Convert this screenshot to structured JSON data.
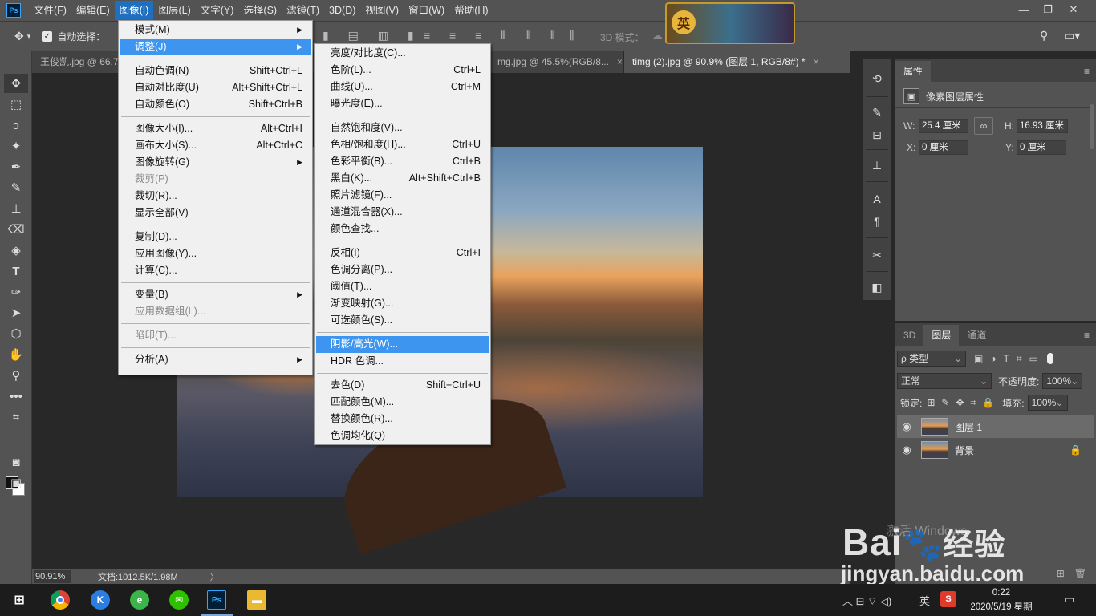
{
  "menubar": {
    "logo": "Ps",
    "items": [
      "文件(F)",
      "编辑(E)",
      "图像(I)",
      "图层(L)",
      "文字(Y)",
      "选择(S)",
      "滤镜(T)",
      "3D(D)",
      "视图(V)",
      "窗口(W)",
      "帮助(H)"
    ],
    "active_index": 2,
    "minimize": "—",
    "restore": "❐",
    "close": "✕",
    "banner_seal": "英"
  },
  "options": {
    "auto_select_label": "自动选择：",
    "mode_3d_label": "3D 模式："
  },
  "tabs": [
    {
      "label": "王俊凯.jpg @ 66.7...",
      "active": false
    },
    {
      "label": "mg.jpg @ 45.5%(RGB/8...",
      "active": false,
      "close": "×"
    },
    {
      "label": "timg (2).jpg @ 90.9% (图层 1, RGB/8#) *",
      "active": true,
      "close": "×"
    }
  ],
  "status": {
    "zoom": "90.91%",
    "doc_info": "文档:1012.5K/1.98M",
    "arrow": "〉"
  },
  "image_menu": {
    "items": [
      {
        "label": "模式(M)",
        "shortcut": "",
        "submenu": true
      },
      {
        "label": "调整(J)",
        "shortcut": "",
        "submenu": true,
        "highlight": true
      },
      {
        "sep": true
      },
      {
        "label": "自动色调(N)",
        "shortcut": "Shift+Ctrl+L"
      },
      {
        "label": "自动对比度(U)",
        "shortcut": "Alt+Shift+Ctrl+L"
      },
      {
        "label": "自动颜色(O)",
        "shortcut": "Shift+Ctrl+B"
      },
      {
        "sep": true
      },
      {
        "label": "图像大小(I)...",
        "shortcut": "Alt+Ctrl+I"
      },
      {
        "label": "画布大小(S)...",
        "shortcut": "Alt+Ctrl+C"
      },
      {
        "label": "图像旋转(G)",
        "shortcut": "",
        "submenu": true
      },
      {
        "label": "裁剪(P)",
        "shortcut": "",
        "disabled": true
      },
      {
        "label": "裁切(R)...",
        "shortcut": ""
      },
      {
        "label": "显示全部(V)",
        "shortcut": ""
      },
      {
        "sep": true
      },
      {
        "label": "复制(D)...",
        "shortcut": ""
      },
      {
        "label": "应用图像(Y)...",
        "shortcut": ""
      },
      {
        "label": "计算(C)...",
        "shortcut": ""
      },
      {
        "sep": true
      },
      {
        "label": "变量(B)",
        "shortcut": "",
        "submenu": true
      },
      {
        "label": "应用数据组(L)...",
        "shortcut": "",
        "disabled": true
      },
      {
        "sep": true
      },
      {
        "label": "陷印(T)...",
        "shortcut": "",
        "disabled": true
      },
      {
        "sep": true
      },
      {
        "label": "分析(A)",
        "shortcut": "",
        "submenu": true
      }
    ]
  },
  "adjust_menu": {
    "items": [
      {
        "label": "亮度/对比度(C)...",
        "shortcut": ""
      },
      {
        "label": "色阶(L)...",
        "shortcut": "Ctrl+L"
      },
      {
        "label": "曲线(U)...",
        "shortcut": "Ctrl+M"
      },
      {
        "label": "曝光度(E)...",
        "shortcut": ""
      },
      {
        "sep": true
      },
      {
        "label": "自然饱和度(V)...",
        "shortcut": ""
      },
      {
        "label": "色相/饱和度(H)...",
        "shortcut": "Ctrl+U"
      },
      {
        "label": "色彩平衡(B)...",
        "shortcut": "Ctrl+B"
      },
      {
        "label": "黑白(K)...",
        "shortcut": "Alt+Shift+Ctrl+B"
      },
      {
        "label": "照片滤镜(F)...",
        "shortcut": ""
      },
      {
        "label": "通道混合器(X)...",
        "shortcut": ""
      },
      {
        "label": "颜色查找...",
        "shortcut": ""
      },
      {
        "sep": true
      },
      {
        "label": "反相(I)",
        "shortcut": "Ctrl+I"
      },
      {
        "label": "色调分离(P)...",
        "shortcut": ""
      },
      {
        "label": "阈值(T)...",
        "shortcut": ""
      },
      {
        "label": "渐变映射(G)...",
        "shortcut": ""
      },
      {
        "label": "可选颜色(S)...",
        "shortcut": ""
      },
      {
        "sep": true
      },
      {
        "label": "阴影/高光(W)...",
        "shortcut": "",
        "highlight": true
      },
      {
        "label": "HDR 色调...",
        "shortcut": ""
      },
      {
        "sep": true
      },
      {
        "label": "去色(D)",
        "shortcut": "Shift+Ctrl+U"
      },
      {
        "label": "匹配颜色(M)...",
        "shortcut": ""
      },
      {
        "label": "替换颜色(R)...",
        "shortcut": ""
      },
      {
        "label": "色调均化(Q)",
        "shortcut": ""
      }
    ]
  },
  "properties": {
    "tab": "属性",
    "header": "像素图层属性",
    "w_label": "W:",
    "w_value": "25.4 厘米",
    "h_label": "H:",
    "h_value": "16.93 厘米",
    "x_label": "X:",
    "x_value": "0 厘米",
    "y_label": "Y:",
    "y_value": "0 厘米"
  },
  "layers": {
    "tabs": [
      "3D",
      "图层",
      "通道"
    ],
    "active_tab": 1,
    "filter_kind": "ρ 类型",
    "blend_mode": "正常",
    "opacity_label": "不透明度:",
    "opacity_value": "100%",
    "lock_label": "锁定:",
    "fill_label": "填充:",
    "fill_value": "100%",
    "items": [
      {
        "name": "图层 1",
        "selected": true,
        "locked": false
      },
      {
        "name": "背景",
        "selected": false,
        "locked": true
      }
    ]
  },
  "watermark": {
    "logo": "Bai",
    "logo_cn": "经验",
    "url": "jingyan.baidu.com",
    "activate": "激活 Windows"
  },
  "taskbar": {
    "ime": "英",
    "time": "0:22",
    "date": "2020/5/19 星期二"
  },
  "colors": {
    "menu_highlight": "#3d95f0",
    "ui_gray": "#535353",
    "canvas_bg": "#282828"
  }
}
